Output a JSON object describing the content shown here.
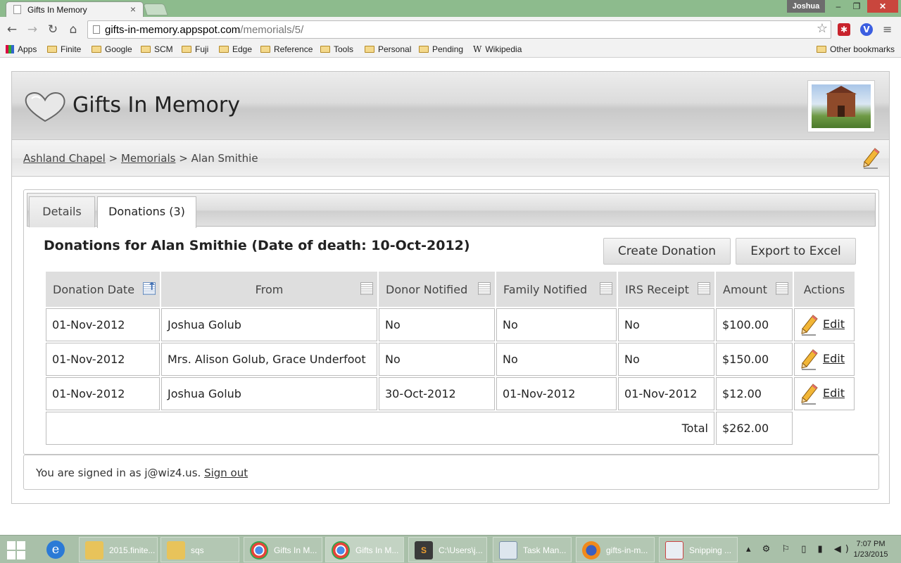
{
  "browser": {
    "tab_title": "Gifts In Memory",
    "tab_close": "×",
    "user": "Joshua",
    "window_controls": {
      "minimize": "–",
      "maximize": "❐",
      "close": "✕"
    },
    "nav": {
      "back": "←",
      "forward": "→",
      "reload": "↻",
      "home": "⌂"
    },
    "url_host": "gifts-in-memory.appspot.com",
    "url_path": "/memorials/5/",
    "star_icon": "☆",
    "ext_red": "✱",
    "ext_blue": "V",
    "menu_icon": "≡",
    "bookmarks": [
      {
        "label": "Apps",
        "icon": "apps-icon"
      },
      {
        "label": "Finite",
        "icon": "folder-icon"
      },
      {
        "label": "Google",
        "icon": "folder-icon"
      },
      {
        "label": "SCM",
        "icon": "folder-icon"
      },
      {
        "label": "Fuji",
        "icon": "folder-icon"
      },
      {
        "label": "Edge",
        "icon": "folder-icon"
      },
      {
        "label": "Reference",
        "icon": "folder-icon"
      },
      {
        "label": "Tools",
        "icon": "folder-icon"
      },
      {
        "label": "Personal",
        "icon": "folder-icon"
      },
      {
        "label": "Pending",
        "icon": "folder-icon"
      },
      {
        "label": "Wikipedia",
        "icon": "wikipedia-icon"
      }
    ],
    "other_bookmarks": "Other bookmarks"
  },
  "site": {
    "title": "Gifts In Memory"
  },
  "breadcrumb": {
    "level1": "Ashland Chapel",
    "sep1": ">",
    "level2": "Memorials",
    "sep2": ">",
    "current": "Alan Smithie"
  },
  "tabs": {
    "details": "Details",
    "donations": "Donations (3)"
  },
  "donations": {
    "heading": "Donations for Alan Smithie (Date of death: 10-Oct-2012)",
    "create_button": "Create Donation",
    "export_button": "Export to Excel",
    "columns": [
      "Donation Date",
      "From",
      "Donor Notified",
      "Family Notified",
      "IRS Receipt",
      "Amount",
      "Actions"
    ],
    "rows": [
      {
        "date": "01-Nov-2012",
        "from": "Joshua Golub",
        "donor_notified": "No",
        "family_notified": "No",
        "irs_receipt": "No",
        "amount": "$100.00",
        "action": "Edit"
      },
      {
        "date": "01-Nov-2012",
        "from": "Mrs. Alison Golub, Grace Underfoot",
        "donor_notified": "No",
        "family_notified": "No",
        "irs_receipt": "No",
        "amount": "$150.00",
        "action": "Edit"
      },
      {
        "date": "01-Nov-2012",
        "from": "Joshua Golub",
        "donor_notified": "30-Oct-2012",
        "family_notified": "01-Nov-2012",
        "irs_receipt": "01-Nov-2012",
        "amount": "$12.00",
        "action": "Edit"
      }
    ],
    "total_label": "Total",
    "total_value": "$262.00"
  },
  "footer": {
    "signed_in_prefix": "You are signed in as j@wiz4.us.",
    "sign_out": "Sign out"
  },
  "taskbar": {
    "items": [
      {
        "label": "2015.finite...",
        "icon": "folder-icon"
      },
      {
        "label": "sqs",
        "icon": "folder-icon"
      },
      {
        "label": "Gifts In M...",
        "icon": "chrome-icon"
      },
      {
        "label": "Gifts In M...",
        "icon": "chrome-icon"
      },
      {
        "label": "C:\\Users\\j...",
        "icon": "sublime-icon"
      },
      {
        "label": "Task Man...",
        "icon": "task-manager-icon"
      },
      {
        "label": "gifts-in-m...",
        "icon": "firefox-icon"
      },
      {
        "label": "Snipping ...",
        "icon": "snipping-tool-icon"
      }
    ],
    "tray_icons": "▴ ⚙ ⚐ ▯ ▮ ◀)",
    "time": "7:07 PM",
    "date": "1/23/2015"
  },
  "colors": {
    "chrome_frame": "#8dbb8d",
    "taskbar": "#a9c0a9",
    "close_button": "#c9463d",
    "header_gray": "#dcdcdc"
  }
}
